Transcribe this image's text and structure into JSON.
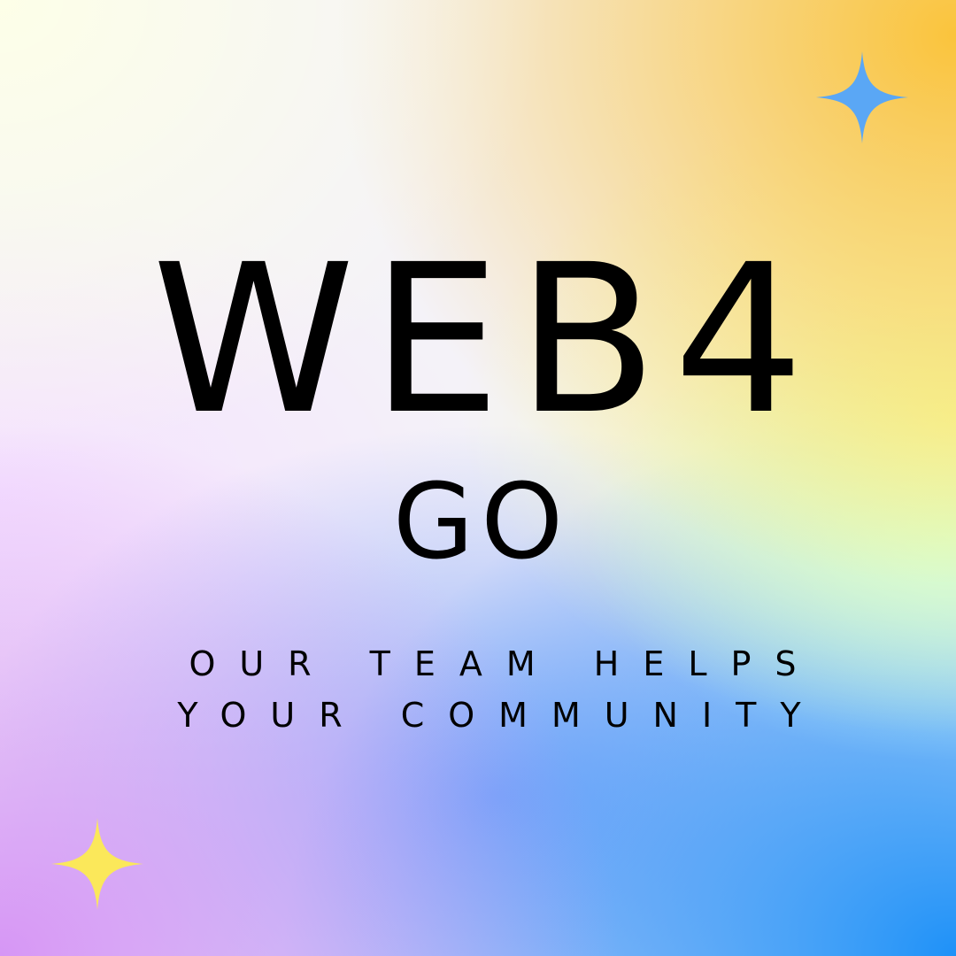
{
  "heading": {
    "title": "WEB4",
    "subtitle": "GO"
  },
  "tagline": {
    "line1": "OUR TEAM HELPS",
    "line2": "YOUR COMMUNITY"
  },
  "decorations": {
    "sparkle_top_right": {
      "icon": "four-point-star-icon",
      "color": "#5aa7f5"
    },
    "sparkle_bottom_left": {
      "icon": "four-point-star-icon",
      "color": "#fbe85a"
    }
  },
  "colors": {
    "text": "#000000",
    "gradient_top_left": "#fdffe8",
    "gradient_top_right": "#fac43c",
    "gradient_bottom_left": "#d696f5",
    "gradient_bottom_right": "#1e91f8"
  }
}
